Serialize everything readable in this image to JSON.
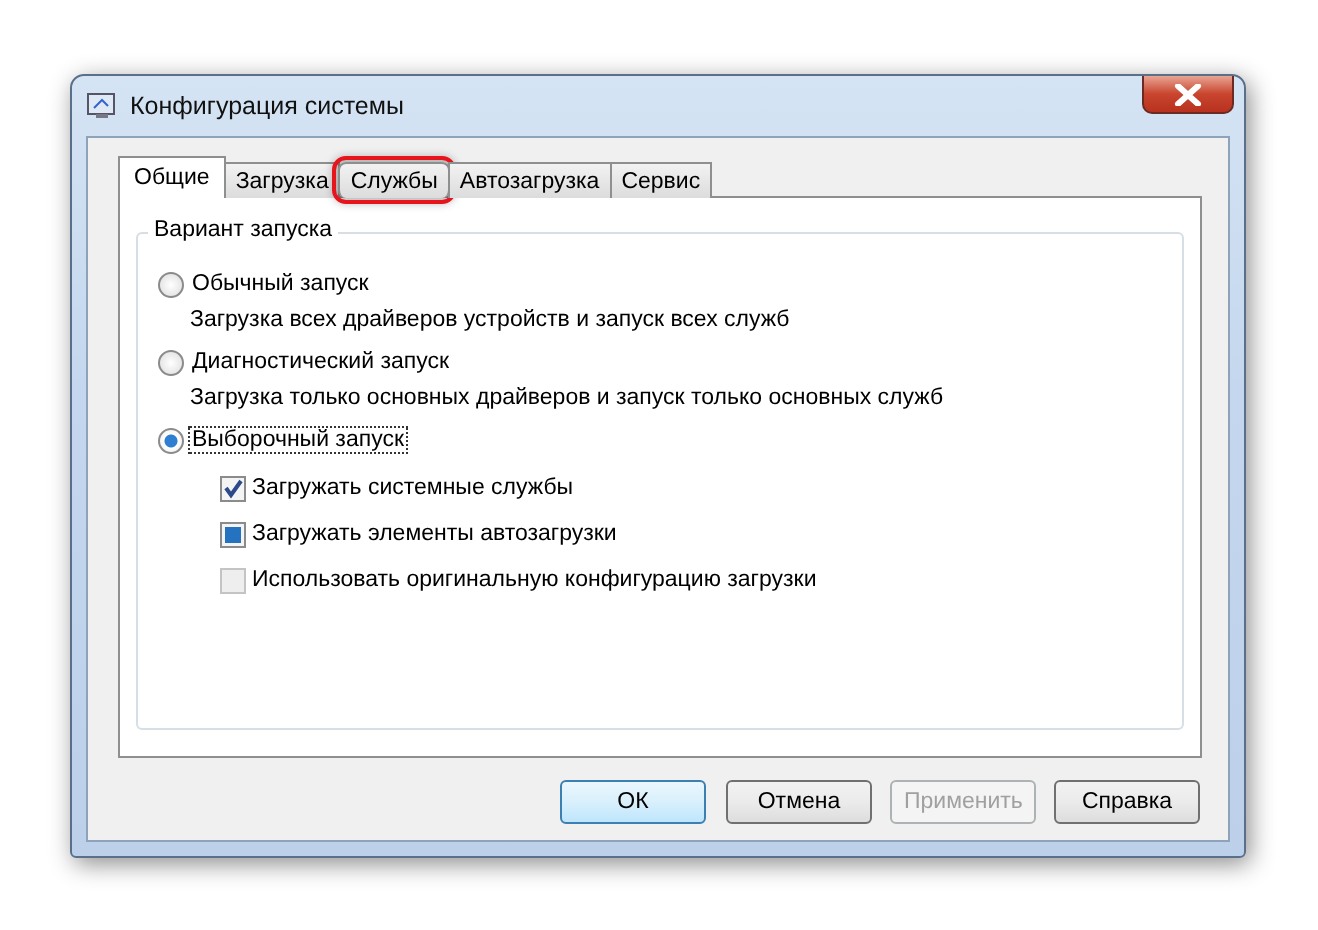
{
  "window": {
    "title": "Конфигурация системы"
  },
  "tabs": [
    {
      "label": "Общие",
      "selected": true,
      "highlighted": false
    },
    {
      "label": "Загрузка",
      "selected": false,
      "highlighted": false
    },
    {
      "label": "Службы",
      "selected": false,
      "highlighted": true
    },
    {
      "label": "Автозагрузка",
      "selected": false,
      "highlighted": false
    },
    {
      "label": "Сервис",
      "selected": false,
      "highlighted": false
    }
  ],
  "group": {
    "title": "Вариант запуска",
    "options": [
      {
        "label": "Обычный запуск",
        "description": "Загрузка всех драйверов устройств и запуск всех служб",
        "selected": false
      },
      {
        "label": "Диагностический запуск",
        "description": "Загрузка только основных драйверов и запуск только основных служб",
        "selected": false
      },
      {
        "label": "Выборочный запуск",
        "selected": true,
        "checkboxes": [
          {
            "label": "Загружать системные службы",
            "checked": true,
            "disabled": false
          },
          {
            "label": "Загружать элементы автозагрузки",
            "checked": false,
            "indeterminate": true,
            "disabled": false
          },
          {
            "label": "Использовать оригинальную конфигурацию загрузки",
            "checked": false,
            "disabled": true
          }
        ]
      }
    ]
  },
  "buttons": [
    {
      "label": "ОК",
      "default": true,
      "disabled": false
    },
    {
      "label": "Отмена",
      "default": false,
      "disabled": false
    },
    {
      "label": "Применить",
      "default": false,
      "disabled": true
    },
    {
      "label": "Справка",
      "default": false,
      "disabled": false
    }
  ]
}
